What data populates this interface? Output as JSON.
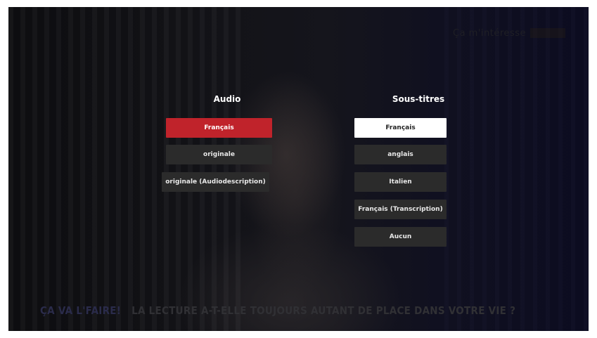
{
  "logo_text": "Ça m'intéresse",
  "audio": {
    "title": "Audio",
    "options": [
      "Français",
      "originale",
      "originale (Audiodescription)"
    ],
    "selected": "Français",
    "selected_color": "#c0232b"
  },
  "subtitles": {
    "title": "Sous-titres",
    "options": [
      "Français",
      "anglais",
      "Italien",
      "Français (Transcription)",
      "Aucun"
    ],
    "selected": "Français",
    "selected_color": "#ffffff"
  },
  "banner": {
    "highlight": "ÇA VA L'FAIRE!",
    "text": "LA LECTURE A-T-ELLE TOUJOURS AUTANT DE PLACE DANS VOTRE VIE ?"
  }
}
